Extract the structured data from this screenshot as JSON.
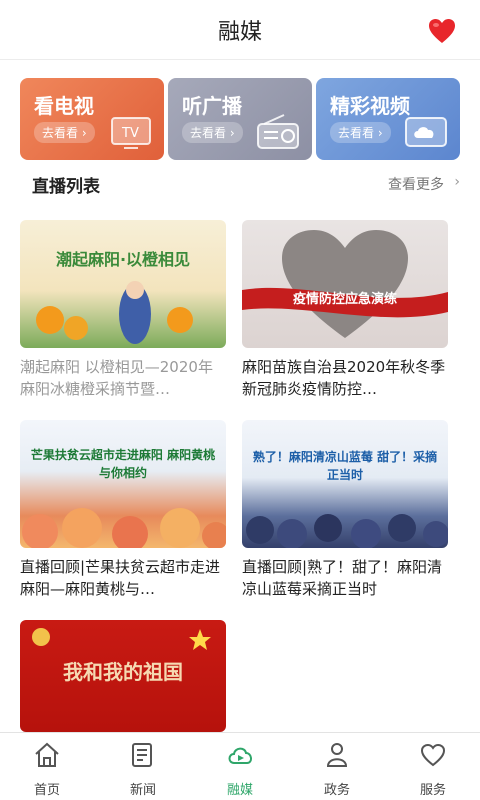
{
  "header": {
    "title": "融媒",
    "heart_icon": "heart-icon"
  },
  "channels": [
    {
      "label": "看电视",
      "go": "去看看 ›",
      "icon": "tv-icon",
      "color": "#e86c44"
    },
    {
      "label": "听广播",
      "go": "去看看 ›",
      "icon": "radio-icon",
      "color": "#9a9db0"
    },
    {
      "label": "精彩视频",
      "go": "去看看 ›",
      "icon": "cloud-video-icon",
      "color": "#6b93d8"
    }
  ],
  "section": {
    "title": "直播列表",
    "more": "查看更多",
    "more_icon": "chevron-right-icon"
  },
  "cards": [
    {
      "title": "潮起麻阳 以橙相见—2020年麻阳冰糖橙采摘节暨…",
      "banner": "潮起麻阳·以橙相见"
    },
    {
      "title": "麻阳苗族自治县2020年秋冬季新冠肺炎疫情防控…",
      "banner": "疫情防控应急演练"
    },
    {
      "title": "直播回顾|芒果扶贫云超市走进麻阳—麻阳黄桃与…",
      "banner": "芒果扶贫云超市走进麻阳 麻阳黄桃与你相约"
    },
    {
      "title": "直播回顾|熟了！甜了！麻阳清凉山蓝莓采摘正当时",
      "banner": "熟了！麻阳清凉山蓝莓 甜了！采摘正当时"
    },
    {
      "title": "",
      "banner": "我和我的祖国"
    }
  ],
  "tabs": [
    {
      "label": "首页",
      "icon": "home-icon"
    },
    {
      "label": "新闻",
      "icon": "news-icon"
    },
    {
      "label": "融媒",
      "icon": "media-cloud-icon",
      "active": true
    },
    {
      "label": "政务",
      "icon": "government-icon"
    },
    {
      "label": "服务",
      "icon": "service-heart-icon"
    }
  ],
  "colors": {
    "accent": "#2fa66a",
    "heart": "#e8262b"
  }
}
